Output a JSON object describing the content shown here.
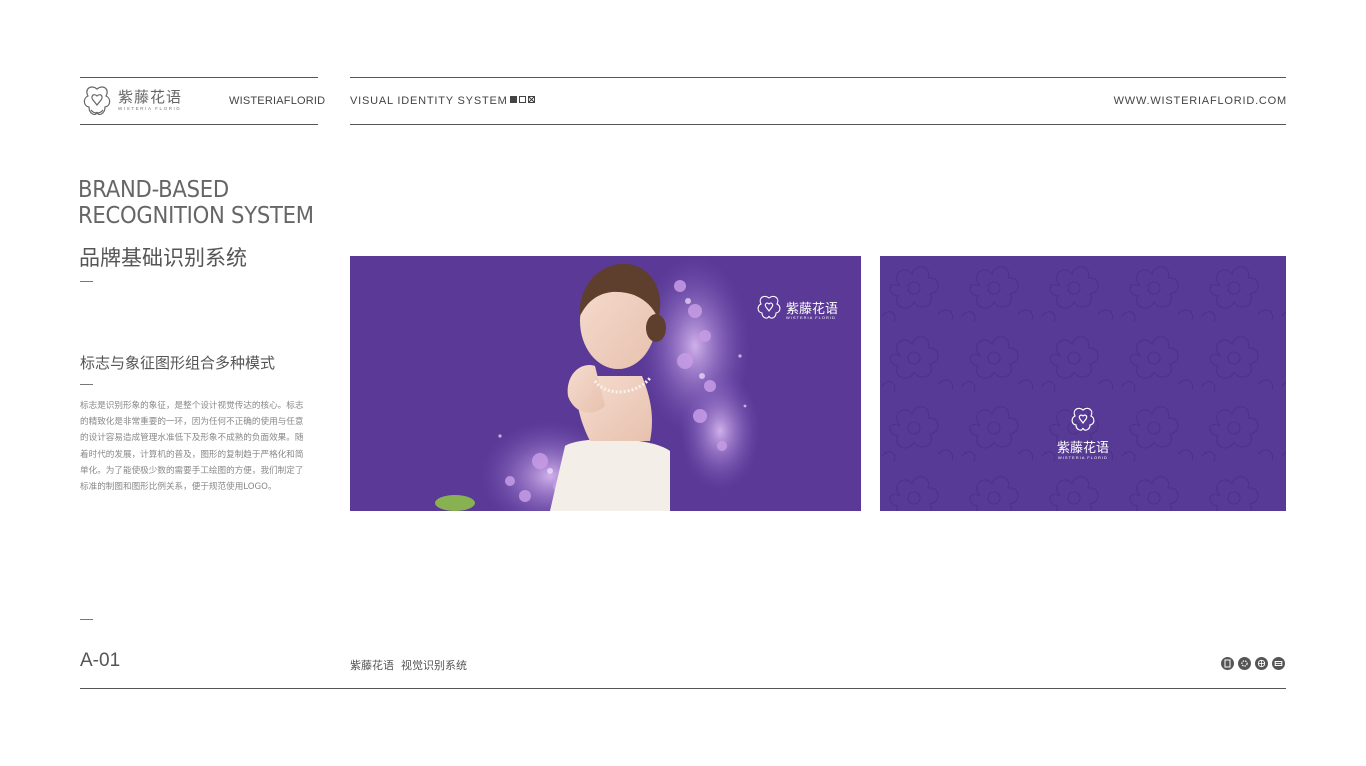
{
  "header": {
    "logo_cn": "紫藤花语",
    "logo_en": "WISTERIA FLORID",
    "brand_en": "WISTERIAFLORID",
    "system_title": "VISUAL IDENTITY SYSTEM",
    "website": "WWW.WISTERIAFLORID.COM",
    "square_icons": [
      "filled-square-icon",
      "outline-square-icon",
      "crossed-square-icon"
    ]
  },
  "left": {
    "heading_en_line1": "BRAND-BASED",
    "heading_en_line2": "RECOGNITION SYSTEM",
    "heading_cn": "品牌基础识别系统",
    "subheading_cn": "标志与象征图形组合多种模式",
    "body": "标志是识别形象的象征，是整个设计视觉传达的核心。标志的精致化是非常重要的一环，因为任何不正确的使用与任意的设计容易造成管理水准低下及形象不成熟的负面效果。随着时代的发展，计算机的普及，图形的复制趋于严格化和简单化。为了能使极少数的需要手工绘图的方便，我们制定了标准的制图和图形比例关系，便于规范使用LOGO。"
  },
  "panels": {
    "panel1_logo_cn": "紫藤花语",
    "panel1_logo_en": "WISTERIA FLORID",
    "panel2_logo_cn": "紫藤花语",
    "panel2_logo_en": "WISTERIA FLORID",
    "purple": "#5a3a96"
  },
  "footer": {
    "page_number": "A-01",
    "title": "紫藤花语  视觉识别系统",
    "icons": [
      "document-icon",
      "settings-icon",
      "globe-icon",
      "message-icon"
    ]
  }
}
